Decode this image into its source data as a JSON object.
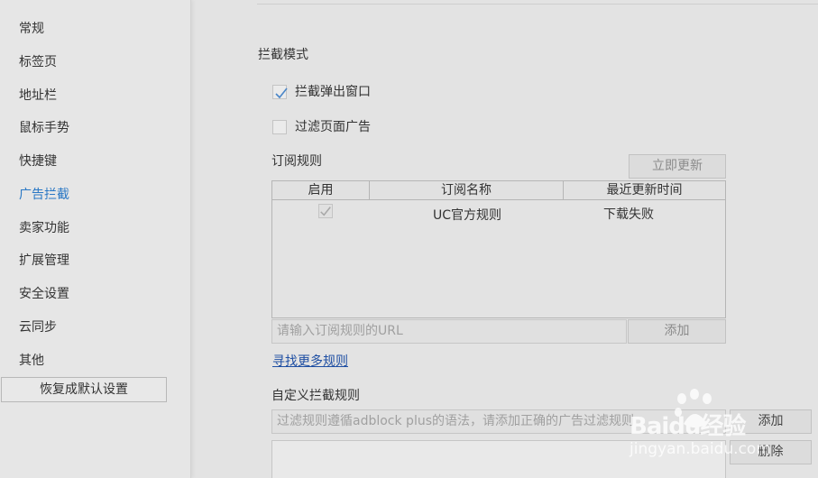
{
  "sidebar": {
    "items": [
      {
        "label": "常规"
      },
      {
        "label": "标签页"
      },
      {
        "label": "地址栏"
      },
      {
        "label": "鼠标手势"
      },
      {
        "label": "快捷键"
      },
      {
        "label": "广告拦截",
        "active": true
      },
      {
        "label": "卖家功能"
      },
      {
        "label": "扩展管理"
      },
      {
        "label": "安全设置"
      },
      {
        "label": "云同步"
      },
      {
        "label": "其他"
      }
    ],
    "reset_label": "恢复成默认设置"
  },
  "block_mode": {
    "title": "拦截模式",
    "popup_label": "拦截弹出窗口",
    "popup_checked": true,
    "ads_label": "过滤页面广告",
    "ads_checked": false
  },
  "subscriptions": {
    "title": "订阅规则",
    "update_label": "立即更新",
    "columns": [
      "启用",
      "订阅名称",
      "最近更新时间"
    ],
    "rows": [
      {
        "enabled": true,
        "name": "UC官方规则",
        "updated": "下载失败"
      }
    ],
    "url_placeholder": "请输入订阅规则的URL",
    "add_label": "添加",
    "more_link": "寻找更多规则"
  },
  "custom": {
    "title": "自定义拦截规则",
    "placeholder": "过滤规则遵循adblock plus的语法，请添加正确的广告过滤规则",
    "add_label": "添加",
    "delete_label": "删除"
  },
  "watermark": {
    "brand": "Baidu经验",
    "url": "jingyan.baidu.com"
  },
  "colors": {
    "active_nav": "#2a78c5",
    "link": "#1f4fa3",
    "check": "#4a86c8"
  }
}
